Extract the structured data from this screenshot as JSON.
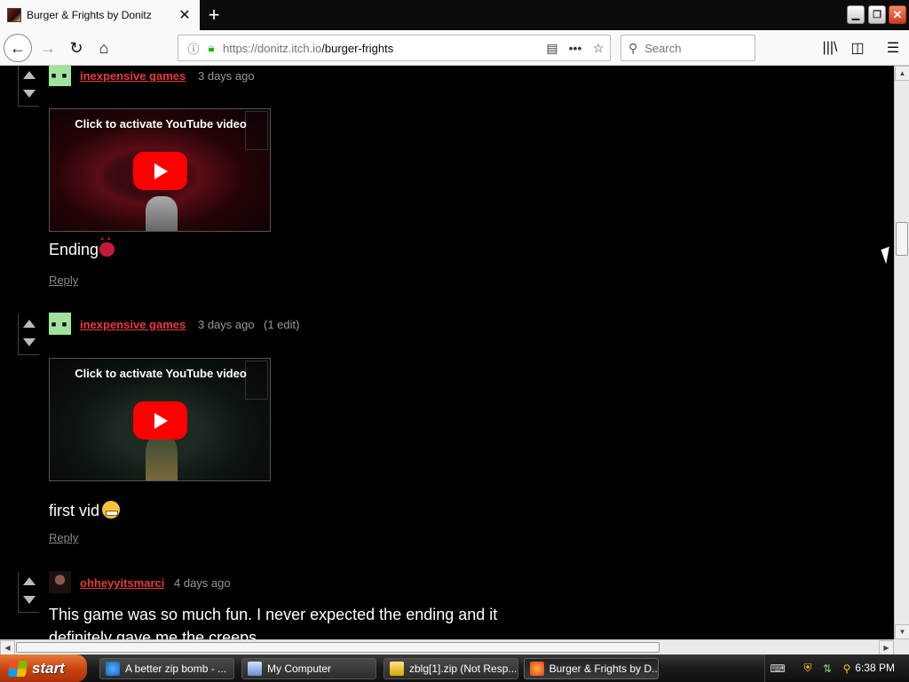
{
  "browser": {
    "tab_title": "Burger & Frights by Donitz",
    "new_tab_symbol": "+",
    "url_host": "https://donitz.itch.io",
    "url_path": "/burger-frights",
    "search_placeholder": "Search"
  },
  "comments": [
    {
      "author": "inexpensive games",
      "time": "3 days ago",
      "edit": "",
      "video_label": "Click to activate YouTube video",
      "text": "Ending",
      "emoji": "devil-face",
      "reply": "Reply"
    },
    {
      "author": "inexpensive games",
      "time": "3 days ago",
      "edit": "(1 edit)",
      "video_label": "Click to activate YouTube video",
      "text": "first vid",
      "emoji": "grimace-face",
      "reply": "Reply"
    },
    {
      "author": "ohheyyitsmarci",
      "time": "4 days ago",
      "text_line1": "This game was so much fun. I never expected the ending and it",
      "text_line2": "definitely gave me the creeps."
    }
  ],
  "taskbar": {
    "start_label": "start",
    "items": [
      {
        "label": "A better zip bomb - ..."
      },
      {
        "label": "My Computer"
      },
      {
        "label": "zblg[1].zip (Not Resp..."
      },
      {
        "label": "Burger & Frights by D..."
      }
    ],
    "clock": "6:38 PM"
  },
  "colors": {
    "author_link": "#e83b3b",
    "page_bg": "#000000",
    "youtube_red": "#ff0000"
  }
}
